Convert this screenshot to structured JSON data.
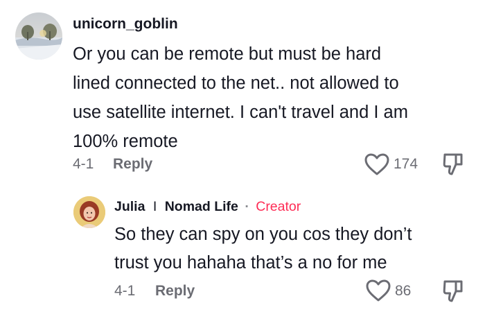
{
  "comments": [
    {
      "username": "unicorn_goblin",
      "avatar": "landscape-avatar",
      "text_lines": [
        "Or you can be remote but must be hard",
        "lined connected to the net.. not allowed to",
        "use satellite internet. I can't travel and I am",
        "100% remote"
      ],
      "date": "4-1",
      "reply_label": "Reply",
      "like_count": "174",
      "like_icon": "heart-outline-icon",
      "dislike_icon": "thumbs-down-icon"
    }
  ],
  "reply": {
    "username": "Julia",
    "separator": "I",
    "channel_name": "Nomad Life",
    "dot": "·",
    "badge": "Creator",
    "avatar": "portrait-avatar",
    "text_lines": [
      "So they can spy on you cos they don’t",
      "trust you hahaha that’s a no for me"
    ],
    "date": "4-1",
    "reply_label": "Reply",
    "like_count": "86",
    "like_icon": "heart-outline-icon",
    "dislike_icon": "thumbs-down-icon"
  },
  "colors": {
    "text": "#161823",
    "muted": "#6b6c73",
    "creator_badge": "#fe2c55"
  }
}
